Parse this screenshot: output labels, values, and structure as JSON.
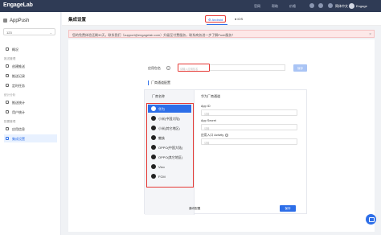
{
  "topbar": {
    "logo": "EngageLab",
    "nav": [
      "官网",
      "帮助",
      "价格"
    ],
    "lang": "简体中文",
    "user": "Engage"
  },
  "sidebar": {
    "app_title": "AppPush",
    "app_select_value": "123",
    "items_top": [
      {
        "label": "概况"
      }
    ],
    "section_push": "推送管理",
    "items_push": [
      {
        "label": "创建推送"
      },
      {
        "label": "推送记录"
      },
      {
        "label": "定时任务"
      }
    ],
    "section_stats": "统计分析",
    "items_stats": [
      {
        "label": "推送统计"
      },
      {
        "label": "用户统计"
      }
    ],
    "section_config": "配置管理",
    "items_config": [
      {
        "label": "应用信息"
      },
      {
        "label": "集成设置"
      }
    ]
  },
  "main": {
    "page_title": "集成设置",
    "tabs": [
      {
        "label": "Android"
      },
      {
        "label": "iOS"
      }
    ],
    "notice": "您的免费体验还剩30天，联系我们（support@engagelab.com）升级至付费服务，联系商务进一步了解Push服务！",
    "notice_close": "×",
    "package_label": "应用包名",
    "package_help": "?",
    "package_placeholder": "请输入应用包名",
    "save_top": "保存",
    "section_title": "厂商通道配置",
    "vendor_header": "厂商名称",
    "vendors": [
      {
        "label": "华为"
      },
      {
        "label": "小米(中国大陆)"
      },
      {
        "label": "小米(其它地区)"
      },
      {
        "label": "魅族"
      },
      {
        "label": "OPPO(中国大陆)"
      },
      {
        "label": "OPPO(其它地区)"
      },
      {
        "label": "Vivo"
      },
      {
        "label": "FCM"
      }
    ],
    "vendor_title": "华为厂商通道",
    "fields": [
      {
        "label": "App ID",
        "placeholder": "请输"
      },
      {
        "label": "App Secret",
        "placeholder": "请输"
      },
      {
        "label": "应用入口 Activity",
        "placeholder": "请输"
      }
    ],
    "guide_link": "通讯配置",
    "save_bottom": "保存"
  },
  "colors": {
    "accent": "#2d6ee8",
    "topbar": "#2f3b55",
    "highlight": "#e53935"
  }
}
